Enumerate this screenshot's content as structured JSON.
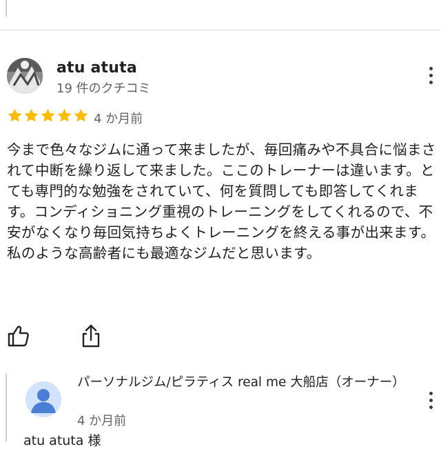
{
  "review": {
    "author_name": "atu atuta",
    "author_meta": "19 件のクチコミ",
    "rating": 5,
    "rating_max": 5,
    "date": "4 か月前",
    "text": "今まで色々なジムに通って来ましたが、毎回痛みや不具合に悩まされて中断を繰り返して来ました。ここのトレーナーは違います。とても専門的な勉強をされていて、何を質問しても即答してくれます。コンディショニング重視のトレーニングをしてくれるので、不安がなくなり毎回気持ちよくトレーニングを終える事が出来ます。\n私のような高齢者にも最適なジムだと思います。",
    "star_color": "#fbbc04"
  },
  "actions": {
    "like_icon": "thumbs-up-icon",
    "share_icon": "share-icon"
  },
  "owner_reply": {
    "name": "パーソナルジム/ピラティス real me 大船店（オーナー）",
    "date": "4 か月前",
    "snippet": "atu atuta 様"
  },
  "colors": {
    "text_primary": "#202124",
    "text_secondary": "#5f6368",
    "owner_avatar_fg": "#4a7fd6",
    "owner_avatar_bg": "#d2e3fc"
  }
}
